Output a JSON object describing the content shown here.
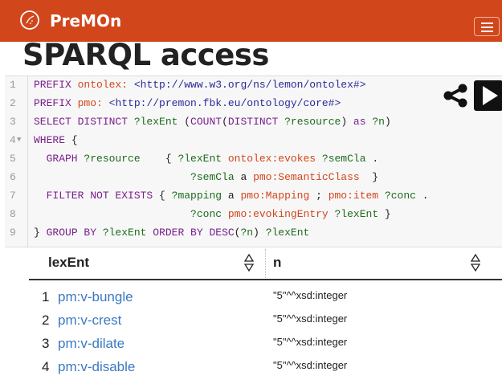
{
  "navbar": {
    "brand": "PreMOn",
    "menu_label": "Toggle navigation",
    "color": "#d2461c"
  },
  "page": {
    "title": "SPARQL access"
  },
  "query": {
    "lines": [
      {
        "num": "1",
        "fold": "",
        "segments": [
          {
            "t": "PREFIX ",
            "c": "kw"
          },
          {
            "t": "ontolex:",
            "c": "pfx"
          },
          {
            "t": " ",
            "c": ""
          },
          {
            "t": "<http://www.w3.org/ns/lemon/ontolex#>",
            "c": "uri"
          }
        ]
      },
      {
        "num": "2",
        "fold": "",
        "segments": [
          {
            "t": "PREFIX ",
            "c": "kw"
          },
          {
            "t": "pmo:",
            "c": "pfx"
          },
          {
            "t": " ",
            "c": ""
          },
          {
            "t": "<http://premon.fbk.eu/ontology/core#>",
            "c": "uri"
          }
        ]
      },
      {
        "num": "3",
        "fold": "",
        "segments": [
          {
            "t": "SELECT DISTINCT ",
            "c": "kw"
          },
          {
            "t": "?lexEnt",
            "c": "var"
          },
          {
            "t": " (",
            "c": ""
          },
          {
            "t": "COUNT",
            "c": "kw"
          },
          {
            "t": "(",
            "c": ""
          },
          {
            "t": "DISTINCT ",
            "c": "kw"
          },
          {
            "t": "?resource",
            "c": "var"
          },
          {
            "t": ") ",
            "c": ""
          },
          {
            "t": "as ",
            "c": "kw"
          },
          {
            "t": "?n",
            "c": "var"
          },
          {
            "t": ")",
            "c": ""
          }
        ]
      },
      {
        "num": "4",
        "fold": "▼",
        "segments": [
          {
            "t": "WHERE",
            "c": "kw"
          },
          {
            "t": " {",
            "c": ""
          }
        ]
      },
      {
        "num": "5",
        "fold": "",
        "segments": [
          {
            "t": "  GRAPH ",
            "c": "kw"
          },
          {
            "t": "?resource",
            "c": "var"
          },
          {
            "t": "    { ",
            "c": ""
          },
          {
            "t": "?lexEnt",
            "c": "var"
          },
          {
            "t": " ",
            "c": ""
          },
          {
            "t": "ontolex:evokes",
            "c": "pfx"
          },
          {
            "t": " ",
            "c": ""
          },
          {
            "t": "?semCla",
            "c": "var"
          },
          {
            "t": " .",
            "c": ""
          }
        ]
      },
      {
        "num": "6",
        "fold": "",
        "segments": [
          {
            "t": "                         ",
            "c": ""
          },
          {
            "t": "?semCla",
            "c": "var"
          },
          {
            "t": " a ",
            "c": ""
          },
          {
            "t": "pmo:SemanticClass",
            "c": "pfx"
          },
          {
            "t": "  }",
            "c": ""
          }
        ]
      },
      {
        "num": "7",
        "fold": "",
        "segments": [
          {
            "t": "  FILTER NOT EXISTS",
            "c": "kw"
          },
          {
            "t": " { ",
            "c": ""
          },
          {
            "t": "?mapping",
            "c": "var"
          },
          {
            "t": " a ",
            "c": ""
          },
          {
            "t": "pmo:Mapping",
            "c": "pfx"
          },
          {
            "t": " ; ",
            "c": ""
          },
          {
            "t": "pmo:item",
            "c": "pfx"
          },
          {
            "t": " ",
            "c": ""
          },
          {
            "t": "?conc",
            "c": "var"
          },
          {
            "t": " .",
            "c": ""
          }
        ]
      },
      {
        "num": "8",
        "fold": "",
        "segments": [
          {
            "t": "                         ",
            "c": ""
          },
          {
            "t": "?conc",
            "c": "var"
          },
          {
            "t": " ",
            "c": ""
          },
          {
            "t": "pmo:evokingEntry",
            "c": "pfx"
          },
          {
            "t": " ",
            "c": ""
          },
          {
            "t": "?lexEnt",
            "c": "var"
          },
          {
            "t": " }",
            "c": ""
          }
        ]
      },
      {
        "num": "9",
        "fold": "",
        "segments": [
          {
            "t": "} ",
            "c": ""
          },
          {
            "t": "GROUP BY ",
            "c": "kw"
          },
          {
            "t": "?lexEnt",
            "c": "var"
          },
          {
            "t": " ",
            "c": ""
          },
          {
            "t": "ORDER BY DESC",
            "c": "kw"
          },
          {
            "t": "(",
            "c": ""
          },
          {
            "t": "?n",
            "c": "var"
          },
          {
            "t": ") ",
            "c": ""
          },
          {
            "t": "?lexEnt",
            "c": "var"
          }
        ]
      }
    ]
  },
  "results": {
    "headers": [
      "lexEnt",
      "n"
    ],
    "rows": [
      {
        "num": "1",
        "lexEnt": "pm:v-bungle",
        "n": "\"5\"^^xsd:integer"
      },
      {
        "num": "2",
        "lexEnt": "pm:v-crest",
        "n": "\"5\"^^xsd:integer"
      },
      {
        "num": "3",
        "lexEnt": "pm:v-dilate",
        "n": "\"5\"^^xsd:integer"
      },
      {
        "num": "4",
        "lexEnt": "pm:v-disable",
        "n": "\"5\"^^xsd:integer"
      }
    ]
  }
}
